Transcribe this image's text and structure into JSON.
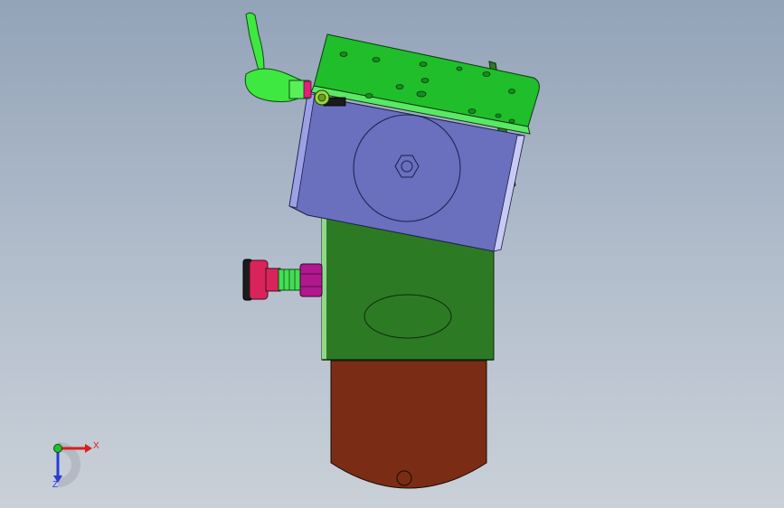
{
  "viewport": {
    "background_top": "#93a3b8",
    "background_bottom": "#c9d0d8"
  },
  "model": {
    "parts": [
      {
        "name": "tilted-mount-plate",
        "color": "#1fbe2a"
      },
      {
        "name": "motor-housing",
        "color": "#6a6fbe"
      },
      {
        "name": "vertical-bracket",
        "color": "#2d7a25"
      },
      {
        "name": "base-plate",
        "color": "#7a2d14"
      },
      {
        "name": "toggle-clamp",
        "color": "#3fe840"
      },
      {
        "name": "indexing-plunger",
        "color": "#d8245a"
      },
      {
        "name": "hex-nut",
        "color": "#b0188e"
      }
    ]
  },
  "triad": {
    "x_label": "X",
    "z_label": "Z",
    "x_color": "#d81e1e",
    "y_color": "#22c02a",
    "z_color": "#2a3ad6"
  }
}
